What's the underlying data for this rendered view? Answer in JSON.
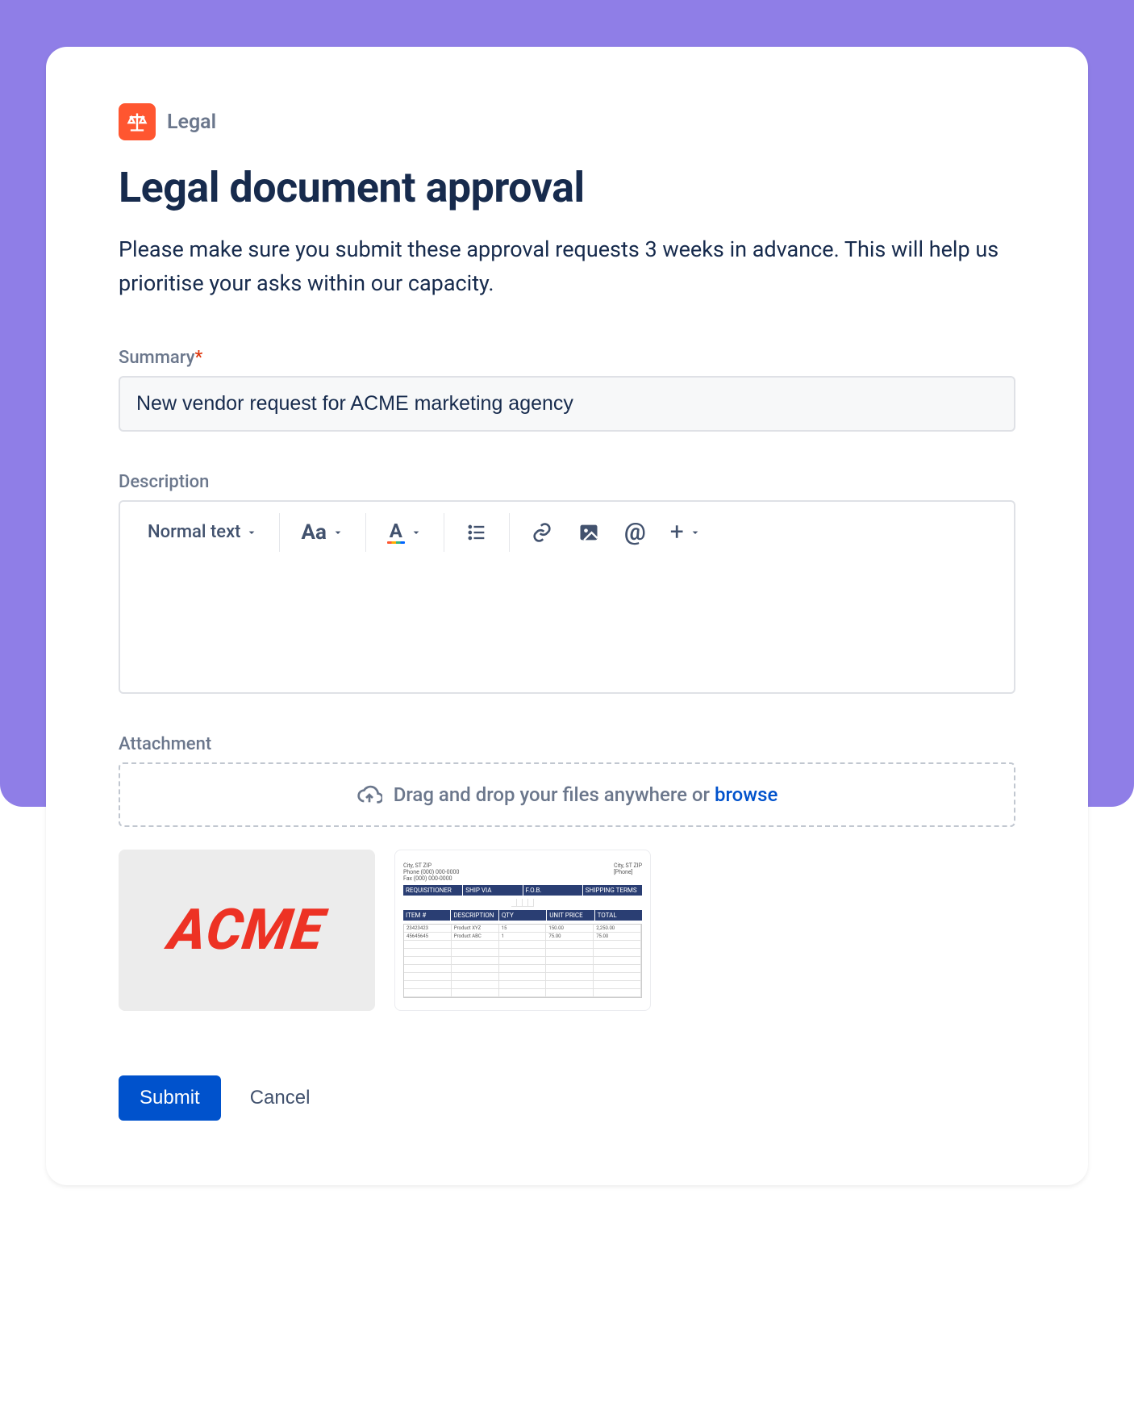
{
  "project": {
    "label": "Legal"
  },
  "page": {
    "title": "Legal document approval",
    "description": "Please make sure you submit these approval requests 3 weeks in advance. This will help us prioritise your asks within our capacity."
  },
  "fields": {
    "summary": {
      "label": "Summary",
      "required_mark": "*",
      "value": "New vendor request for ACME marketing agency"
    },
    "description": {
      "label": "Description",
      "value": "",
      "toolbar": {
        "text_style": "Normal text"
      }
    },
    "attachment": {
      "label": "Attachment",
      "dropzone_text": "Drag and drop your files anywhere or ",
      "dropzone_browse": "browse",
      "thumbs": {
        "acme_text": "ACME",
        "doc_headers1": [
          "REQUISITIONER",
          "SHIP VIA",
          "F.O.B.",
          "SHIPPING TERMS"
        ],
        "doc_headers2": [
          "ITEM #",
          "DESCRIPTION",
          "QTY",
          "UNIT PRICE",
          "TOTAL"
        ],
        "doc_rows": [
          [
            "23423423",
            "Product XYZ",
            "15",
            "150.00",
            "2,250.00"
          ],
          [
            "45645645",
            "Product ABC",
            "1",
            "75.00",
            "75.00"
          ]
        ]
      }
    }
  },
  "actions": {
    "submit": "Submit",
    "cancel": "Cancel"
  }
}
